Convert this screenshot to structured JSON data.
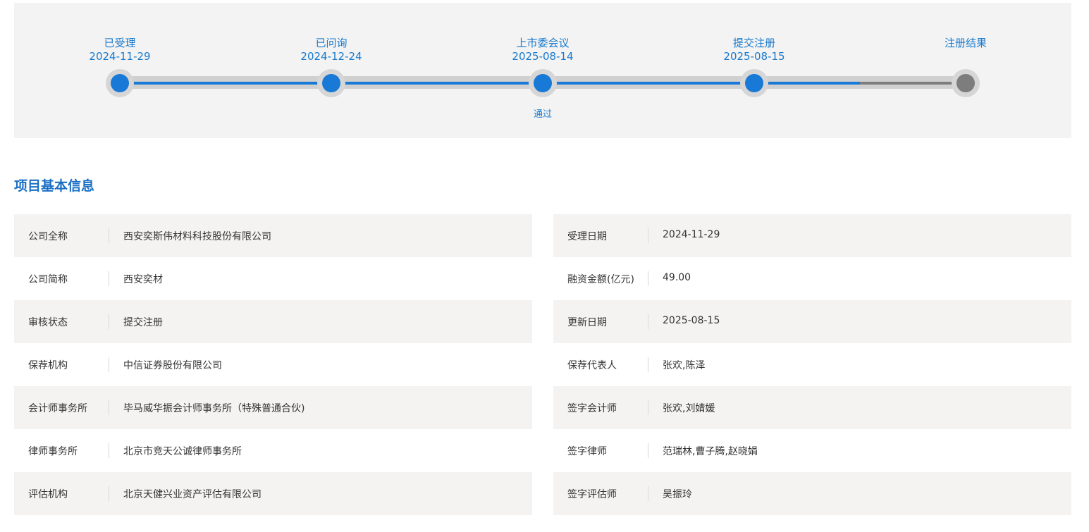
{
  "timeline": {
    "steps": [
      {
        "label": "已受理",
        "date": "2024-11-29",
        "status": "done"
      },
      {
        "label": "已问询",
        "date": "2024-12-24",
        "status": "done"
      },
      {
        "label": "上市委会议",
        "date": "2025-08-14",
        "status": "done",
        "result": "通过"
      },
      {
        "label": "提交注册",
        "date": "2025-08-15",
        "status": "done"
      },
      {
        "label": "注册结果",
        "date": "",
        "status": "pending"
      }
    ]
  },
  "section": {
    "title": "项目基本信息"
  },
  "info": {
    "rows": [
      {
        "left": {
          "key": "公司全称",
          "value": "西安奕斯伟材料科技股份有限公司"
        },
        "right": {
          "key": "受理日期",
          "value": "2024-11-29"
        }
      },
      {
        "left": {
          "key": "公司简称",
          "value": "西安奕材"
        },
        "right": {
          "key": "融资金额(亿元)",
          "value": "49.00"
        }
      },
      {
        "left": {
          "key": "审核状态",
          "value": "提交注册"
        },
        "right": {
          "key": "更新日期",
          "value": "2025-08-15"
        }
      },
      {
        "left": {
          "key": "保荐机构",
          "value": "中信证券股份有限公司"
        },
        "right": {
          "key": "保荐代表人",
          "value": "张欢,陈泽"
        }
      },
      {
        "left": {
          "key": "会计师事务所",
          "value": "毕马威华振会计师事务所（特殊普通合伙)"
        },
        "right": {
          "key": "签字会计师",
          "value": "张欢,刘婧媛"
        }
      },
      {
        "left": {
          "key": "律师事务所",
          "value": "北京市竞天公诚律师事务所"
        },
        "right": {
          "key": "签字律师",
          "value": "范瑞林,曹子腾,赵晓娟"
        }
      },
      {
        "left": {
          "key": "评估机构",
          "value": "北京天健兴业资产评估有限公司"
        },
        "right": {
          "key": "签字评估师",
          "value": "吴振玲"
        }
      }
    ]
  },
  "colors": {
    "accent": "#1879d6",
    "title": "#1a6fc4",
    "pending": "#7d7d7d",
    "row_shade": "#f4f3f2"
  }
}
